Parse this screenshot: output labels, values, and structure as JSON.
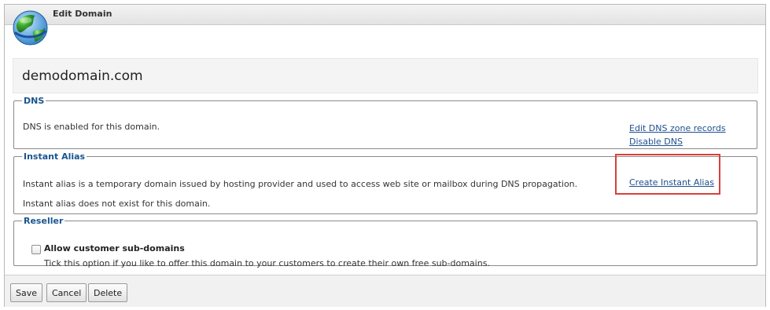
{
  "window": {
    "title": "Edit Domain",
    "icon": "globe-icon"
  },
  "domain": {
    "name": "demodomain.com"
  },
  "dns": {
    "legend": "DNS",
    "status_text": "DNS is enabled for this domain.",
    "links": {
      "edit_zone": "Edit DNS zone records",
      "disable": "Disable DNS"
    }
  },
  "instant_alias": {
    "legend": "Instant Alias",
    "description": "Instant alias is a temporary domain issued by hosting provider and used to access web site or mailbox during DNS propagation.",
    "status_text": "Instant alias does not exist for this domain.",
    "create_link": "Create Instant Alias",
    "highlight_color": "#d9403a"
  },
  "reseller": {
    "legend": "Reseller",
    "checkbox_label": "Allow customer sub-domains",
    "checkbox_checked": false,
    "hint": "Tick this option if you like to offer this domain to your customers to create their own free sub-domains."
  },
  "actions": {
    "save": "Save",
    "cancel": "Cancel",
    "delete": "Delete"
  },
  "colors": {
    "legend_text": "#1a5590",
    "link_text": "#1f4f8f"
  }
}
